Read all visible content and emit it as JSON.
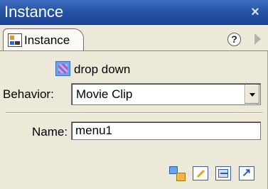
{
  "window": {
    "title": "Instance",
    "close_glyph": "×"
  },
  "tabs": [
    {
      "label": "Instance",
      "icon": "instance-icon"
    }
  ],
  "header_icons": {
    "help": "?",
    "options": "panel-options-arrow"
  },
  "symbol": {
    "name": "drop down",
    "icon": "movie-clip-symbol-icon"
  },
  "behavior": {
    "label": "Behavior:",
    "value": "Movie Clip"
  },
  "name_field": {
    "label": "Name:",
    "value": "menu1"
  },
  "toolbar": [
    {
      "icon": "swap-symbol-icon"
    },
    {
      "icon": "edit-symbol-icon"
    },
    {
      "icon": "duplicate-symbol-icon"
    },
    {
      "icon": "go-to-symbol-icon"
    }
  ],
  "colors": {
    "titlebar": "#2654a6",
    "panel_bg": "#ece9d8",
    "accent": "#2a5fa8"
  }
}
